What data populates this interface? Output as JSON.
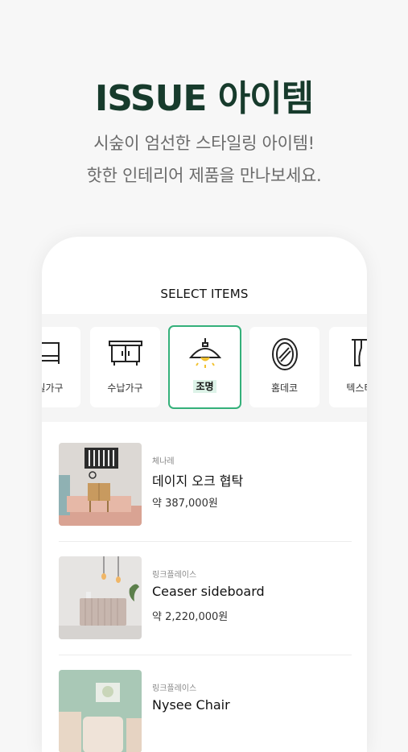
{
  "hero": {
    "title": "ISSUE 아이템",
    "subtitle_line1": "시숲이 엄선한 스타일링 아이템!",
    "subtitle_line2": "핫한 인테리어 제품을 만나보세요."
  },
  "screen": {
    "title": "SELECT ITEMS",
    "categories": [
      {
        "label": "침실가구",
        "icon": "bed-icon",
        "active": false
      },
      {
        "label": "수납가구",
        "icon": "cabinet-icon",
        "active": false
      },
      {
        "label": "조명",
        "icon": "lamp-icon",
        "active": true
      },
      {
        "label": "홈데코",
        "icon": "mirror-icon",
        "active": false
      },
      {
        "label": "텍스타일",
        "icon": "curtain-icon",
        "active": false
      }
    ],
    "products": [
      {
        "brand": "체나레",
        "name": "데이지 오크 협탁",
        "price": "약 387,000원"
      },
      {
        "brand": "링크플레이스",
        "name": "Ceaser sideboard",
        "price": "약 2,220,000원"
      },
      {
        "brand": "링크플레이스",
        "name": "Nysee Chair",
        "price": ""
      }
    ]
  },
  "colors": {
    "accent_green": "#34b07a",
    "title_green": "#173b2c",
    "active_label_bg": "#ddf3e8"
  }
}
